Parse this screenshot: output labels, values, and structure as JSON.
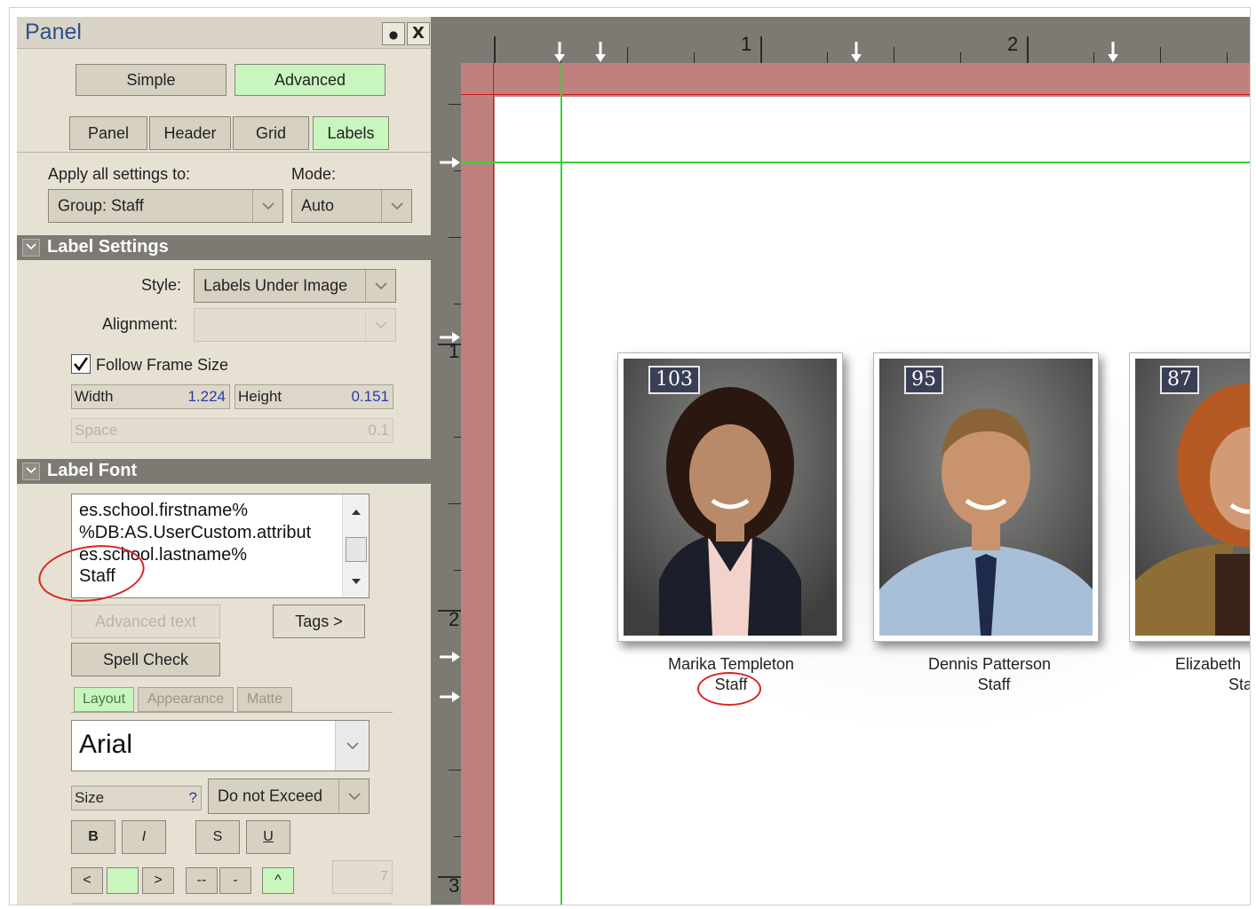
{
  "panel": {
    "title": "Panel",
    "pin_glyph": "●",
    "close_glyph": "X",
    "mode_buttons": {
      "simple": "Simple",
      "advanced": "Advanced"
    },
    "tabs": [
      "Panel",
      "Header",
      "Grid",
      "Labels"
    ],
    "active_tab": "Labels",
    "apply_label": "Apply all settings to:",
    "apply_value": "Group: Staff",
    "mode_label": "Mode:",
    "mode_value": "Auto"
  },
  "label_settings": {
    "header": "Label Settings",
    "style_label": "Style:",
    "style_value": "Labels Under Image",
    "alignment_label": "Alignment:",
    "alignment_value": "",
    "follow_frame_label": "Follow Frame Size",
    "follow_frame_checked": true,
    "width_label": "Width",
    "width_value": "1.224",
    "height_label": "Height",
    "height_value": "0.151",
    "space_label": "Space",
    "space_value": "0.1"
  },
  "label_font": {
    "header": "Label Font",
    "text_lines": [
      "es.school.firstname%",
      "%DB:AS.UserCustom.attribut",
      "es.school.lastname%",
      "Staff"
    ],
    "advanced_text_button": "Advanced text",
    "tags_button": "Tags >",
    "spell_check_button": "Spell Check",
    "subtabs": [
      "Layout",
      "Appearance",
      "Matte"
    ],
    "active_subtab": "Layout",
    "font_name": "Arial",
    "size_label": "Size",
    "size_help": "?",
    "size_mode": "Do not Exceed",
    "style_buttons": [
      "B",
      "I",
      "S",
      "U"
    ],
    "align_buttons": [
      "<",
      ">",
      "--",
      "-",
      "^"
    ],
    "step_value": "7"
  },
  "icons": {
    "dropdown": "chevron-down-icon",
    "collapse": "chevron-down-icon",
    "check": "checkmark-icon",
    "scroll_up": "triangle-up-icon",
    "scroll_down": "triangle-down-icon",
    "ruler_marker": "arrow-icon"
  },
  "ruler": {
    "top_numbers": [
      "1",
      "2"
    ],
    "left_numbers": [
      "1",
      "2",
      "3"
    ]
  },
  "canvas": {
    "margin_color": "#c08080",
    "guide_color": "#38d038",
    "photos": [
      {
        "number": "103",
        "name": "Marika Templeton",
        "group": "Staff"
      },
      {
        "number": "95",
        "name": "Dennis Patterson",
        "group": "Staff"
      },
      {
        "number": "87",
        "name": "Elizabeth",
        "group": "Sta"
      }
    ]
  }
}
